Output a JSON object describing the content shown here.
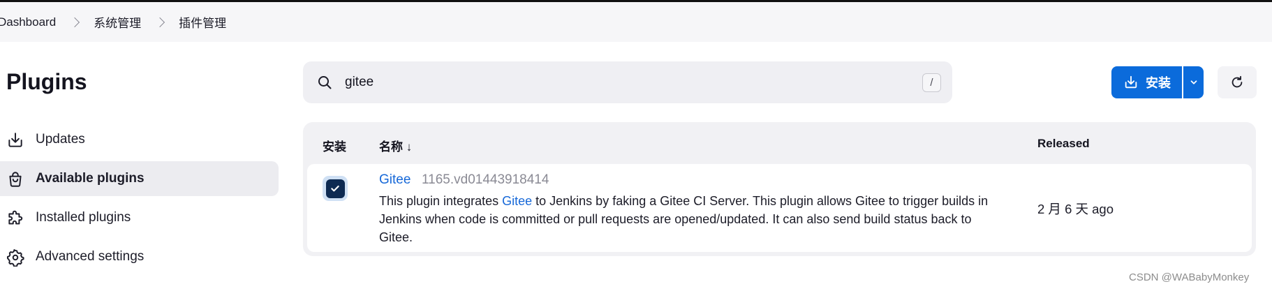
{
  "breadcrumb": {
    "items": [
      "Dashboard",
      "系统管理",
      "插件管理"
    ]
  },
  "page": {
    "title": "Plugins"
  },
  "sidebar": {
    "items": [
      {
        "label": "Updates",
        "icon": "download-icon",
        "active": false
      },
      {
        "label": "Available plugins",
        "icon": "shopping-bag-icon",
        "active": true
      },
      {
        "label": "Installed plugins",
        "icon": "puzzle-icon",
        "active": false
      },
      {
        "label": "Advanced settings",
        "icon": "gear-icon",
        "active": false
      }
    ]
  },
  "search": {
    "value": "gitee",
    "shortcut": "/"
  },
  "toolbar": {
    "install_label": "安装"
  },
  "table": {
    "columns": {
      "install": "安装",
      "name": "名称 ↓",
      "released": "Released"
    },
    "rows": [
      {
        "checked": true,
        "name": "Gitee",
        "version": "1165.vd01443918414",
        "description": {
          "before": "This plugin integrates ",
          "link": "Gitee",
          "after": " to Jenkins by faking a Gitee CI Server. This plugin allows Gitee to trigger builds in Jenkins when code is committed or pull requests are opened/updated. It can also send build status back to Gitee."
        },
        "released": "2 月 6 天 ago"
      }
    ]
  },
  "watermark": "CSDN @WABabyMonkey",
  "colors": {
    "accent": "#0b6bdb",
    "link": "#1668d8",
    "checkbox": "#0d2a52"
  }
}
